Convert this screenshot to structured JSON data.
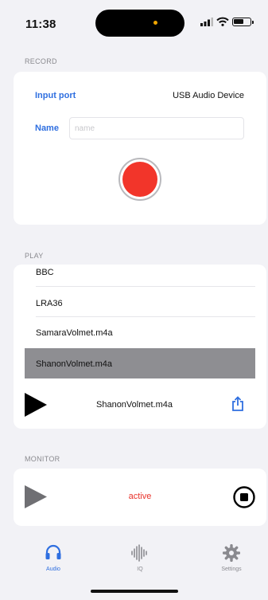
{
  "status_bar": {
    "time": "11:38"
  },
  "record": {
    "section_label": "RECORD",
    "input_port_label": "Input port",
    "input_port_value": "USB Audio Device",
    "name_label": "Name",
    "name_placeholder": "name",
    "name_value": ""
  },
  "play": {
    "section_label": "PLAY",
    "items": [
      {
        "label": "BBC",
        "selected": false
      },
      {
        "label": "LRA36",
        "selected": false
      },
      {
        "label": "SamaraVolmet.m4a",
        "selected": false
      },
      {
        "label": "ShanonVolmet.m4a",
        "selected": true
      }
    ],
    "now_playing": "ShanonVolmet.m4a"
  },
  "monitor": {
    "section_label": "MONITOR",
    "status": "active",
    "status_color": "#e8322a"
  },
  "tab_bar": {
    "tabs": [
      {
        "label": "Audio",
        "icon": "headphones-icon",
        "active": true
      },
      {
        "label": "IQ",
        "icon": "waveform-icon",
        "active": false
      },
      {
        "label": "Settings",
        "icon": "gear-icon",
        "active": false
      }
    ]
  },
  "colors": {
    "accent": "#2f6fe0",
    "record": "#f2352a",
    "selected_row": "#8e8e92"
  }
}
